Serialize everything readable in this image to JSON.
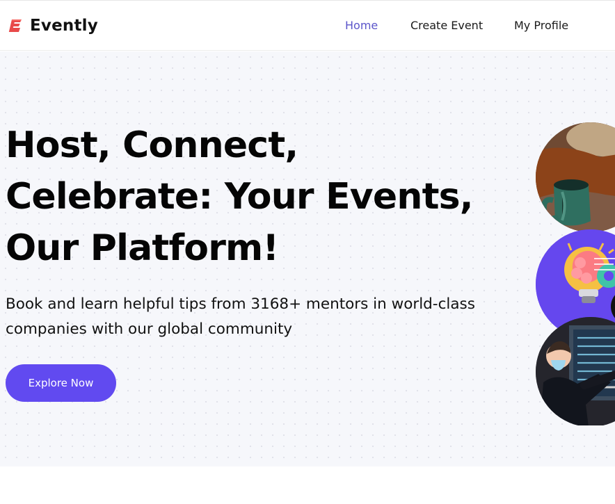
{
  "brand": {
    "name": "Evently",
    "logo_icon": "evently-logo-icon",
    "accent_color": "#614af0",
    "mark_color": "#e84a4a"
  },
  "nav": {
    "items": [
      {
        "label": "Home",
        "active": true
      },
      {
        "label": "Create Event",
        "active": false
      },
      {
        "label": "My Profile",
        "active": false
      }
    ],
    "active_color": "#5b55ca"
  },
  "hero": {
    "title": "Host, Connect, Celebrate: Your Events, Our Platform!",
    "description": "Book and learn helpful tips from 3168+ mentors in world-class companies with our global community",
    "cta_label": "Explore Now"
  },
  "gallery": {
    "items": [
      {
        "icon": "coffee-mug-photo-icon"
      },
      {
        "icon": "brain-idea-illustration-icon"
      },
      {
        "icon": "presentation-photo-icon"
      }
    ]
  }
}
